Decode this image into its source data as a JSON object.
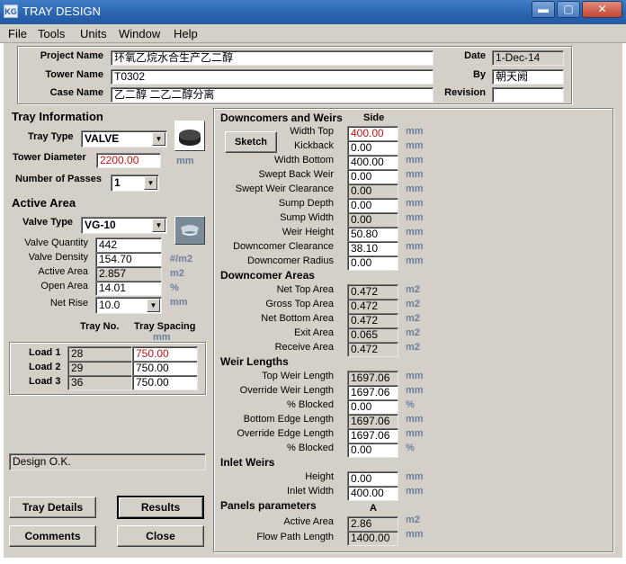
{
  "window": {
    "title": "TRAY DESIGN",
    "icon": "KG",
    "min": "▬",
    "max": "▢",
    "close": "✕"
  },
  "menu": [
    "File",
    "Tools",
    "Units",
    "Window",
    "Help"
  ],
  "project": {
    "project_name_label": "Project Name",
    "project_name": "环氧乙烷水合生产乙二醇",
    "tower_name_label": "Tower Name",
    "tower_name": "T0302",
    "case_name_label": "Case Name",
    "case_name": "乙二醇 二乙二醇分离",
    "date_label": "Date",
    "date": "1-Dec-14",
    "by_label": "By",
    "by": "朝天阙",
    "revision_label": "Revision",
    "revision": ""
  },
  "tray_info": {
    "header": "Tray Information",
    "tray_type_label": "Tray Type",
    "tray_type": "VALVE",
    "tower_diameter_label": "Tower Diameter",
    "tower_diameter": "2200.00",
    "tower_diameter_unit": "mm",
    "passes_label": "Number of Passes",
    "passes": "1"
  },
  "active_area": {
    "header": "Active Area",
    "valve_type_label": "Valve Type",
    "valve_type": "VG-10",
    "rows": [
      {
        "label": "Valve Quantity",
        "value": "442",
        "unit": "",
        "readonly": false
      },
      {
        "label": "Valve Density",
        "value": "154.70",
        "unit": "#/m2",
        "readonly": false
      },
      {
        "label": "Active Area",
        "value": "2.857",
        "unit": "m2",
        "readonly": true
      },
      {
        "label": "Open Area",
        "value": "14.01",
        "unit": "%",
        "readonly": false
      }
    ],
    "net_rise_label": "Net Rise",
    "net_rise": "10.0",
    "net_rise_unit": "mm"
  },
  "loads": {
    "tray_no_header": "Tray No.",
    "spacing_header": "Tray Spacing",
    "spacing_unit": "mm",
    "rows": [
      {
        "label": "Load 1",
        "tray_no": "28",
        "spacing": "750.00",
        "red": true
      },
      {
        "label": "Load 2",
        "tray_no": "29",
        "spacing": "750.00",
        "red": false
      },
      {
        "label": "Load 3",
        "tray_no": "36",
        "spacing": "750.00",
        "red": false
      }
    ]
  },
  "status": "Design O.K.",
  "buttons": {
    "tray_details": "Tray Details",
    "results": "Results",
    "comments": "Comments",
    "close": "Close"
  },
  "downcomers": {
    "header": "Downcomers and Weirs",
    "side_header": "Side",
    "sketch": "Sketch",
    "rows": [
      {
        "label": "Width Top",
        "value": "400.00",
        "unit": "mm",
        "readonly": false,
        "red": true
      },
      {
        "label": "Kickback",
        "value": "0.00",
        "unit": "mm",
        "readonly": false
      },
      {
        "label": "Width Bottom",
        "value": "400.00",
        "unit": "mm",
        "readonly": false
      },
      {
        "label": "Swept Back Weir",
        "value": "0.00",
        "unit": "mm",
        "readonly": false
      },
      {
        "label": "Swept Weir Clearance",
        "value": "0.00",
        "unit": "mm",
        "readonly": true
      },
      {
        "label": "Sump Depth",
        "value": "0.00",
        "unit": "mm",
        "readonly": false
      },
      {
        "label": "Sump Width",
        "value": "0.00",
        "unit": "mm",
        "readonly": true
      },
      {
        "label": "Weir Height",
        "value": "50.80",
        "unit": "mm",
        "readonly": false
      },
      {
        "label": "Downcomer Clearance",
        "value": "38.10",
        "unit": "mm",
        "readonly": false
      },
      {
        "label": "Downcomer Radius",
        "value": "0.00",
        "unit": "mm",
        "readonly": false
      }
    ]
  },
  "downcomer_areas": {
    "header": "Downcomer Areas",
    "rows": [
      {
        "label": "Net Top Area",
        "value": "0.472",
        "unit": "m2"
      },
      {
        "label": "Gross Top Area",
        "value": "0.472",
        "unit": "m2"
      },
      {
        "label": "Net Bottom Area",
        "value": "0.472",
        "unit": "m2"
      },
      {
        "label": "Exit Area",
        "value": "0.065",
        "unit": "m2"
      },
      {
        "label": "Receive Area",
        "value": "0.472",
        "unit": "m2"
      }
    ]
  },
  "weir_lengths": {
    "header": "Weir Lengths",
    "rows": [
      {
        "label": "Top Weir Length",
        "value": "1697.06",
        "unit": "mm",
        "readonly": true
      },
      {
        "label": "Override Weir Length",
        "value": "1697.06",
        "unit": "mm",
        "readonly": false
      },
      {
        "label": "% Blocked",
        "value": "0.00",
        "unit": "%",
        "readonly": false
      },
      {
        "label": "Bottom Edge Length",
        "value": "1697.06",
        "unit": "mm",
        "readonly": true
      },
      {
        "label": "Override Edge Length",
        "value": "1697.06",
        "unit": "mm",
        "readonly": false
      },
      {
        "label": "% Blocked",
        "value": "0.00",
        "unit": "%",
        "readonly": false
      }
    ]
  },
  "inlet_weirs": {
    "header": "Inlet Weirs",
    "rows": [
      {
        "label": "Height",
        "value": "0.00",
        "unit": "mm"
      },
      {
        "label": "Inlet Width",
        "value": "400.00",
        "unit": "mm"
      }
    ]
  },
  "panels": {
    "header": "Panels parameters",
    "column": "A",
    "rows": [
      {
        "label": "Active Area",
        "value": "2.86",
        "unit": "m2"
      },
      {
        "label": "Flow Path Length",
        "value": "1400.00",
        "unit": "mm"
      }
    ]
  }
}
